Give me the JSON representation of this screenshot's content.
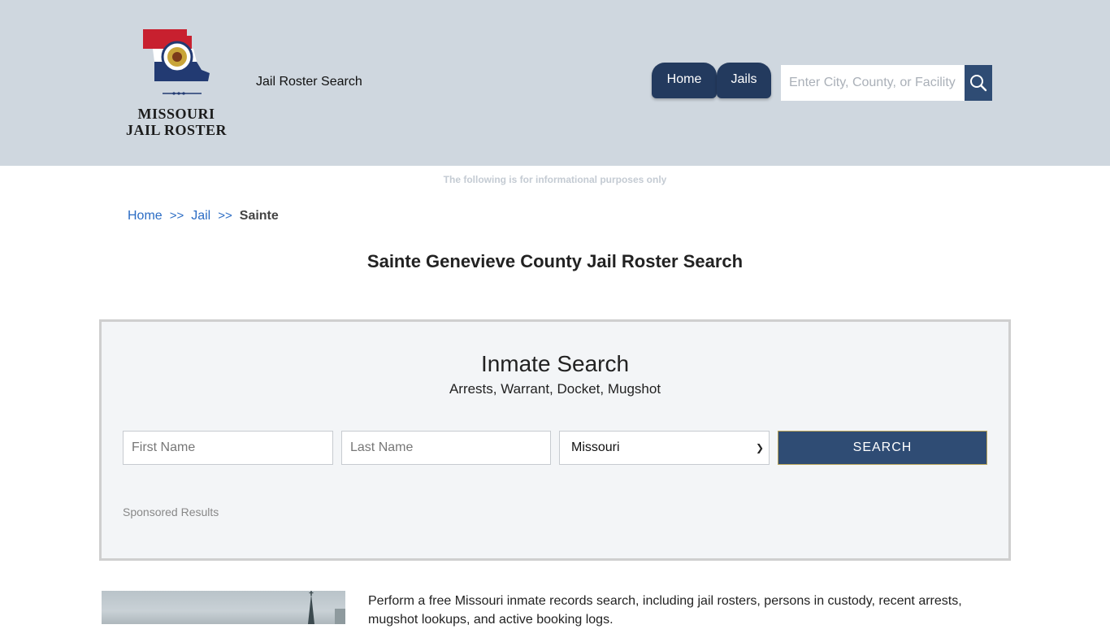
{
  "header": {
    "logo_line1": "MISSOURI",
    "logo_line2": "JAIL ROSTER",
    "tagline": "Jail Roster Search",
    "nav": {
      "home": "Home",
      "jails": "Jails"
    },
    "search_placeholder": "Enter City, County, or Facility"
  },
  "disclaimer": "The following is for informational purposes only",
  "breadcrumb": {
    "home": "Home",
    "sep": ">>",
    "jail": "Jail",
    "current": "Sainte"
  },
  "page_title": "Sainte Genevieve County Jail Roster Search",
  "inmate_search": {
    "title": "Inmate Search",
    "subtitle": "Arrests, Warrant, Docket, Mugshot",
    "first_name_placeholder": "First Name",
    "last_name_placeholder": "Last Name",
    "state_selected": "Missouri",
    "button": "SEARCH",
    "sponsored": "Sponsored Results"
  },
  "intro_text": "Perform a free Missouri inmate records search, including jail rosters, persons in custody, recent arrests, mugshot lookups, and active booking logs.",
  "colors": {
    "header_bg": "#cfd7df",
    "nav_bg": "#233a5e",
    "button_bg": "#2f4c74",
    "link": "#2b6cc4"
  }
}
